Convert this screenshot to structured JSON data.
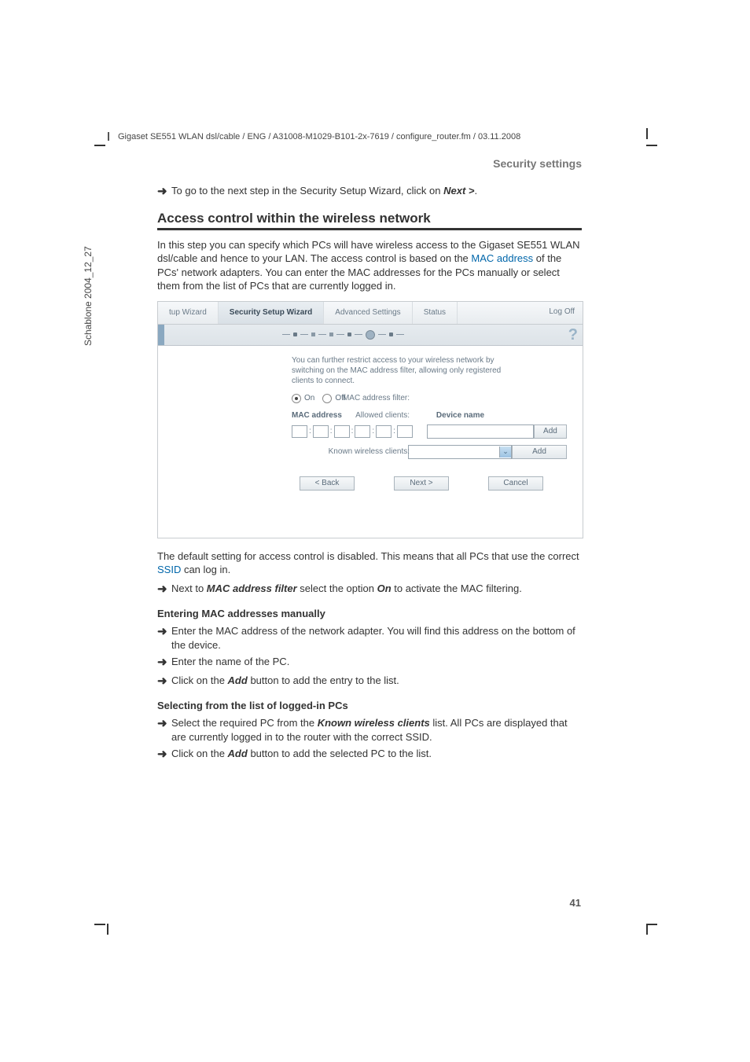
{
  "header": {
    "path": "Gigaset SE551 WLAN dsl/cable / ENG / A31008-M1029-B101-2x-7619 / configure_router.fm / 03.11.2008",
    "vertical": "Schablone 2004_12_27",
    "breadcrumb": "Security settings"
  },
  "intro_step": {
    "pre": "To go to the next step in the Security Setup Wizard, click on ",
    "btn": "Next >",
    "post": "."
  },
  "heading": "Access control within the wireless network",
  "para1": {
    "p1": "In this step you can specify which PCs will have wireless access to the Gigaset SE551 WLAN dsl/cable and hence to your LAN. The access control is based on the ",
    "link": "MAC address",
    "p2": " of the PCs' network adapters. You can enter the MAC addresses for the PCs manually or select them from the list of PCs that are currently logged in."
  },
  "ui": {
    "tabs": {
      "t1": "tup Wizard",
      "t2": "Security Setup Wizard",
      "t3": "Advanced Settings",
      "t4": "Status",
      "logoff": "Log Off"
    },
    "intro": "You can further restrict access to your wireless network by switching on the MAC address filter, allowing only registered clients to connect.",
    "labels": {
      "mac_filter": "MAC address filter:",
      "allowed": "Allowed clients:",
      "known": "Known wireless clients:"
    },
    "radio": {
      "on": "On",
      "off": "Off"
    },
    "cols": {
      "mac": "MAC address",
      "dev": "Device name"
    },
    "buttons": {
      "add": "Add",
      "back": "< Back",
      "next": "Next >",
      "cancel": "Cancel"
    }
  },
  "para2": {
    "p1": "The default setting for access control is disabled. This means that all PCs that use the correct ",
    "link": "SSID",
    "p2": " can log in."
  },
  "step_filter": {
    "pre": "Next to ",
    "b1": "MAC address filter",
    "mid": " select the option ",
    "b2": "On",
    "post": " to activate the MAC filtering."
  },
  "sub1": "Entering MAC addresses manually",
  "s1a": "Enter the MAC address of the network adapter. You will find this address on the bottom of the device.",
  "s1b": "Enter the name of the PC.",
  "s1c": {
    "pre": "Click on the ",
    "b": "Add",
    "post": " button to add the entry to the list."
  },
  "sub2": "Selecting from the list of logged-in PCs",
  "s2a": {
    "pre": "Select the required PC from the ",
    "b": "Known wireless clients",
    "post": " list. All PCs are displayed that are currently logged in to the router with the correct SSID."
  },
  "s2b": {
    "pre": "Click on the ",
    "b": "Add",
    "post": " button to add the selected PC to the list."
  },
  "page_number": "41"
}
